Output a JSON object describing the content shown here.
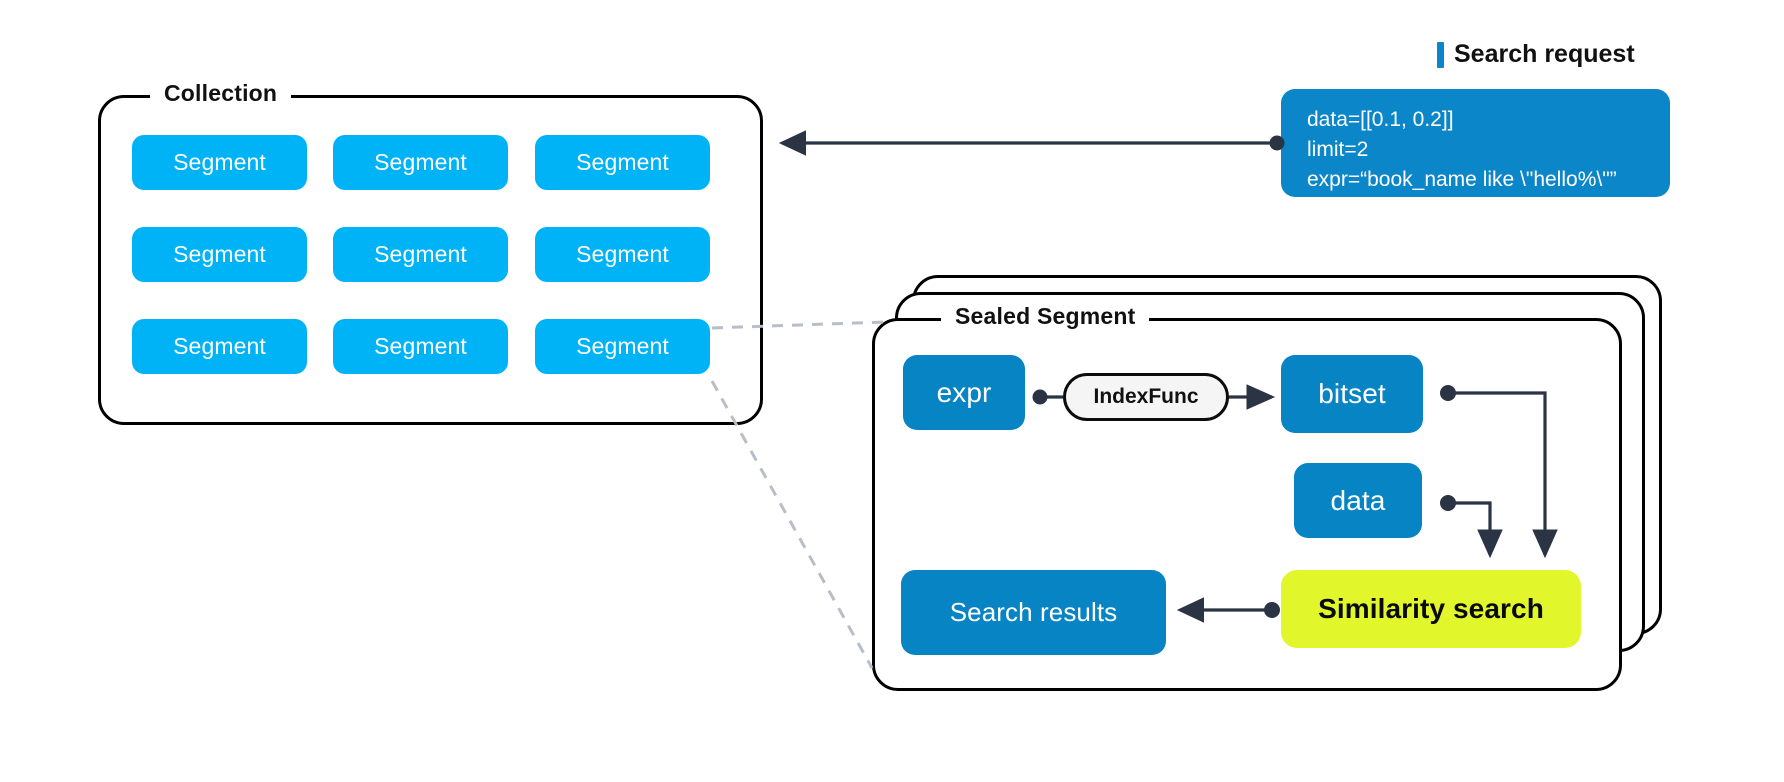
{
  "diagram": {
    "collection": {
      "label": "Collection",
      "segments": [
        {
          "label": "Segment"
        },
        {
          "label": "Segment"
        },
        {
          "label": "Segment"
        },
        {
          "label": "Segment"
        },
        {
          "label": "Segment"
        },
        {
          "label": "Segment"
        },
        {
          "label": "Segment"
        },
        {
          "label": "Segment"
        },
        {
          "label": "Segment"
        }
      ]
    },
    "search_request": {
      "title": "Search request",
      "lines": {
        "data": "data=[[0.1, 0.2]]",
        "limit": "limit=2",
        "expr": "expr=“book_name like \\\"hello%\\\"”"
      }
    },
    "sealed_segment": {
      "label": "Sealed Segment",
      "nodes": {
        "expr": "expr",
        "index_func": "IndexFunc",
        "bitset": "bitset",
        "data": "data",
        "similarity_search": "Similarity search",
        "search_results": "Search results"
      }
    },
    "colors": {
      "segment_cyan": "#00b2f6",
      "node_blue": "#0784c3",
      "request_blue": "#0b86c8",
      "highlight_yellow": "#e1f72b",
      "connector_dark": "#2b3445",
      "dashed_gray": "#b7bec7",
      "outline_black": "#000000"
    }
  }
}
